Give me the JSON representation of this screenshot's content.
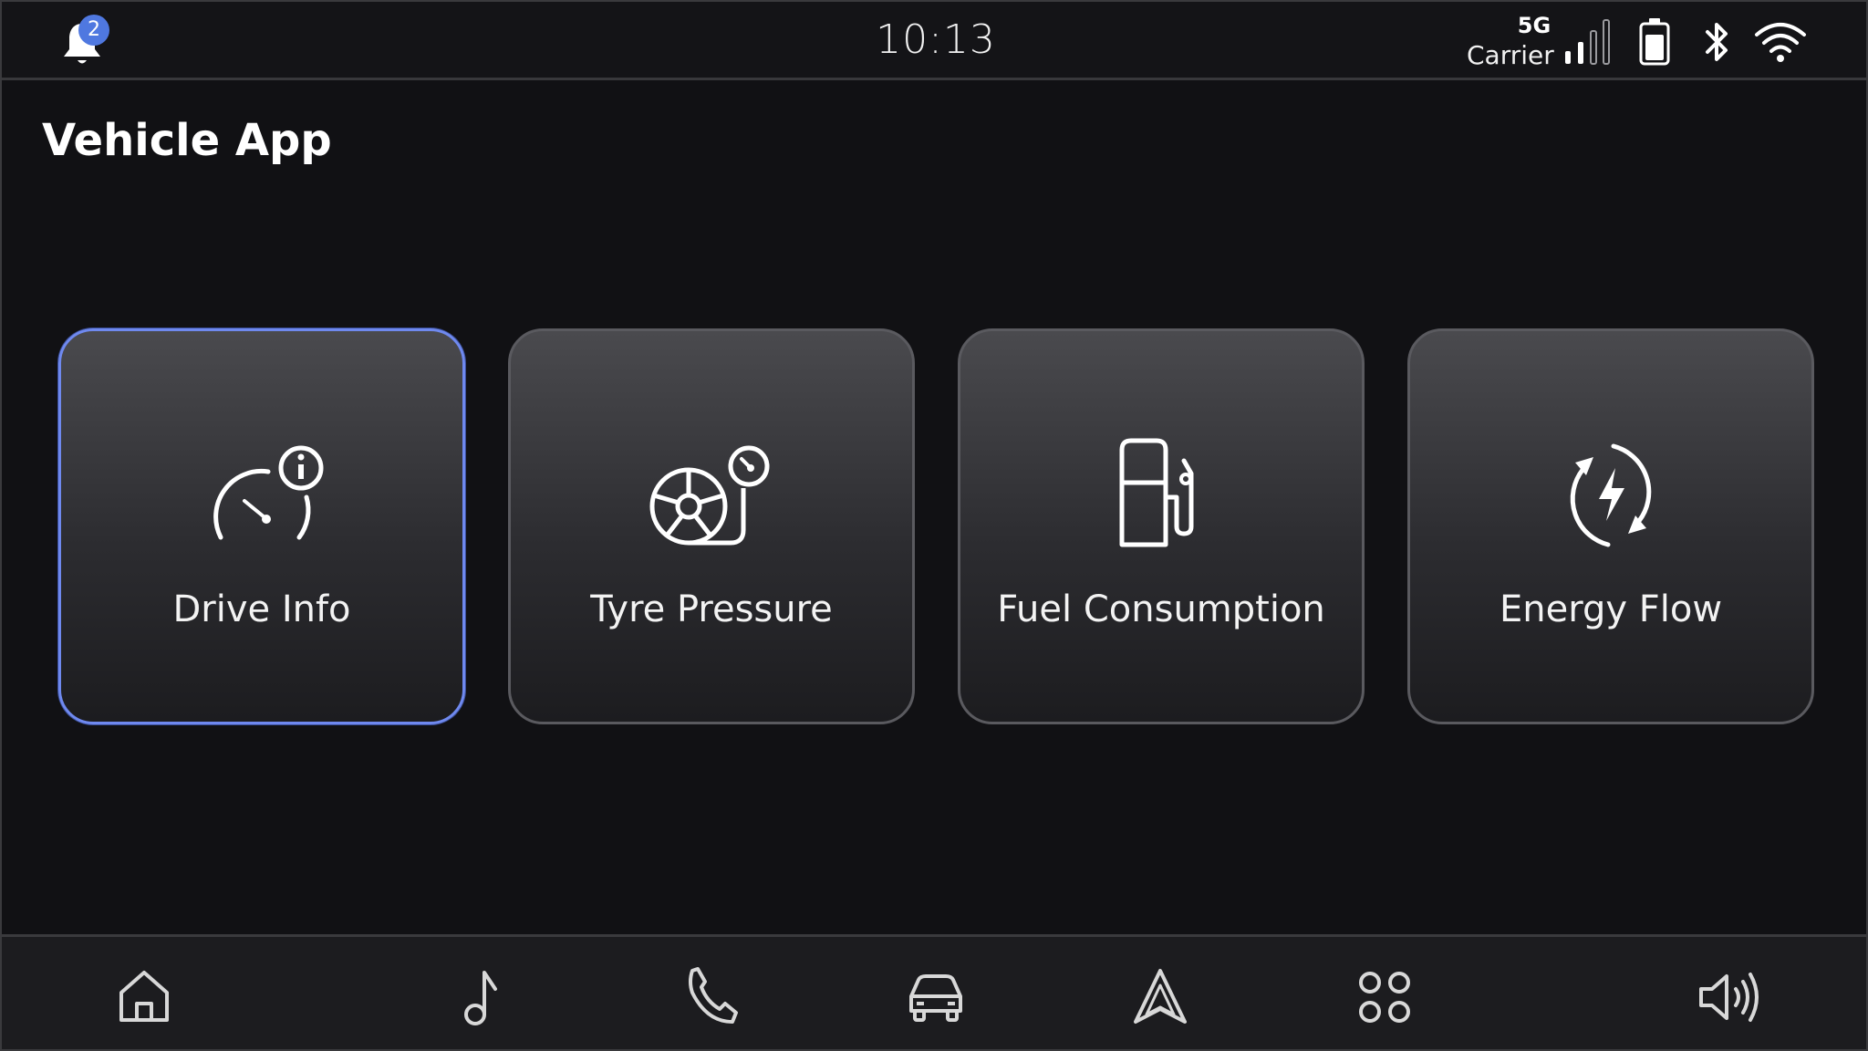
{
  "status_bar": {
    "notification_count": "2",
    "time": "10:13",
    "network_type": "5G",
    "carrier": "Carrier",
    "icons": [
      "bell-icon",
      "signal-icon",
      "battery-icon",
      "bluetooth-icon",
      "wifi-icon"
    ]
  },
  "page": {
    "title": "Vehicle App"
  },
  "tiles": [
    {
      "label": "Drive Info",
      "icon": "speedometer-info-icon",
      "selected": true
    },
    {
      "label": "Tyre Pressure",
      "icon": "tyre-pressure-icon",
      "selected": false
    },
    {
      "label": "Fuel Consumption",
      "icon": "fuel-pump-icon",
      "selected": false
    },
    {
      "label": "Energy Flow",
      "icon": "energy-flow-icon",
      "selected": false
    }
  ],
  "bottom_nav": {
    "items": [
      "home-icon",
      "music-icon",
      "phone-icon",
      "car-icon",
      "navigation-icon",
      "apps-icon",
      "volume-icon"
    ]
  },
  "colors": {
    "background": "#111114",
    "accent": "#6f89ef",
    "badge": "#4f78e0",
    "tile_border": "#5a5a5f"
  }
}
